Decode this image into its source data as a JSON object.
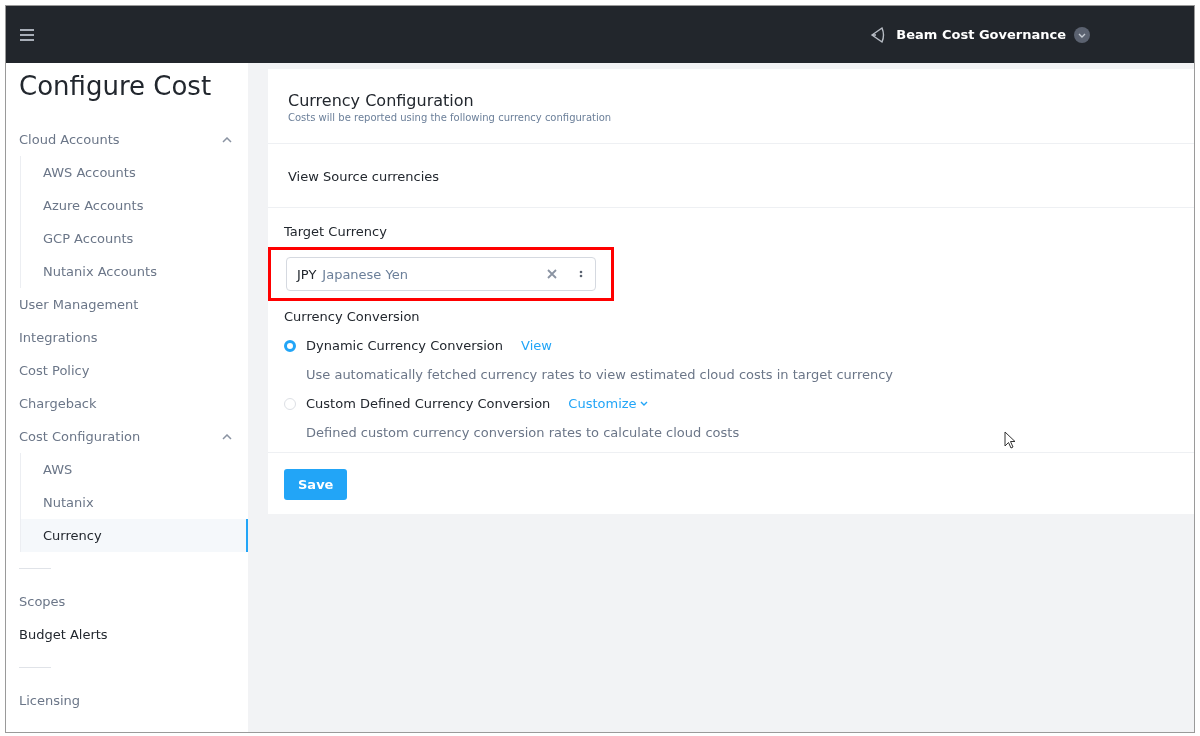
{
  "topbar": {
    "app_name": "Beam Cost Governance"
  },
  "sidebar": {
    "title": "Configure Cost",
    "items": [
      {
        "kind": "group",
        "label": "Cloud Accounts",
        "expanded": true,
        "children": [
          {
            "label": "AWS Accounts",
            "selected": false
          },
          {
            "label": "Azure Accounts",
            "selected": false
          },
          {
            "label": "GCP Accounts",
            "selected": false
          },
          {
            "label": "Nutanix Accounts",
            "selected": false
          }
        ]
      },
      {
        "kind": "link",
        "label": "User Management"
      },
      {
        "kind": "link",
        "label": "Integrations"
      },
      {
        "kind": "link",
        "label": "Cost Policy"
      },
      {
        "kind": "link",
        "label": "Chargeback"
      },
      {
        "kind": "group",
        "label": "Cost Configuration",
        "expanded": true,
        "children": [
          {
            "label": "AWS",
            "selected": false
          },
          {
            "label": "Nutanix",
            "selected": false
          },
          {
            "label": "Currency",
            "selected": true
          }
        ]
      },
      {
        "kind": "divider"
      },
      {
        "kind": "link",
        "label": "Scopes"
      },
      {
        "kind": "strong",
        "label": "Budget Alerts"
      },
      {
        "kind": "divider"
      },
      {
        "kind": "link",
        "label": "Licensing"
      }
    ]
  },
  "main": {
    "title": "Currency Configuration",
    "subtitle": "Costs will be reported using the following currency configuration",
    "source_link": "View Source currencies",
    "target_label": "Target Currency",
    "target": {
      "code": "JPY",
      "name": "Japanese Yen"
    },
    "target_highlighted": true,
    "conversion_label": "Currency Conversion",
    "options": [
      {
        "label": "Dynamic Currency Conversion",
        "action": "View",
        "action_menu": false,
        "description": "Use automatically fetched currency rates to view estimated cloud costs in target currency",
        "selected": true
      },
      {
        "label": "Custom Defined Currency Conversion",
        "action": "Customize",
        "action_menu": true,
        "description": "Defined custom currency conversion rates to calculate cloud costs",
        "selected": false
      }
    ],
    "save": "Save"
  }
}
